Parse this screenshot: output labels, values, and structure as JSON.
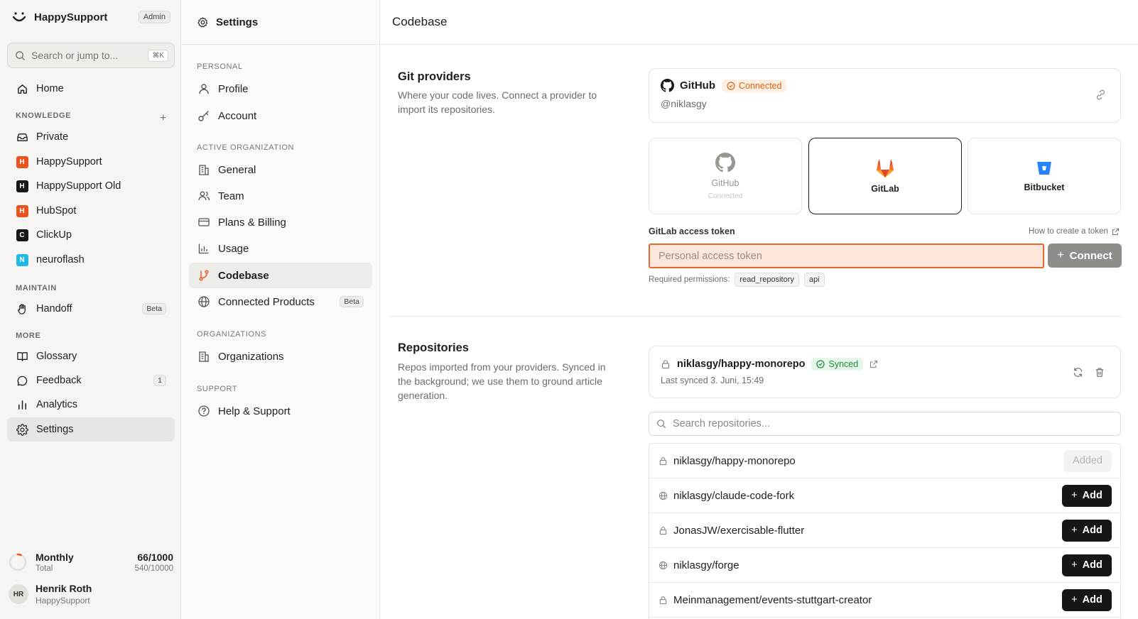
{
  "app": {
    "name": "HappySupport",
    "role_badge": "Admin",
    "search_placeholder": "Search or jump to...",
    "search_shortcut": "⌘K",
    "home": "Home",
    "sections": {
      "knowledge": "KNOWLEDGE",
      "maintain": "MAINTAIN",
      "more": "MORE"
    },
    "knowledge_bases": [
      {
        "label": "Private",
        "icon": "inbox-icon"
      },
      {
        "label": "HappySupport",
        "letter": "H",
        "color": "#e8541f"
      },
      {
        "label": "HappySupport Old",
        "letter": "H",
        "color": "#161616"
      },
      {
        "label": "HubSpot",
        "letter": "H",
        "color": "#e8541f"
      },
      {
        "label": "ClickUp",
        "letter": "C",
        "color": "#161616"
      },
      {
        "label": "neuroflash",
        "letter": "N",
        "color": "#22b8e6"
      }
    ],
    "maintain": {
      "handoff": "Handoff",
      "handoff_badge": "Beta"
    },
    "more": {
      "glossary": "Glossary",
      "feedback": "Feedback",
      "feedback_count": "1",
      "analytics": "Analytics",
      "settings": "Settings"
    },
    "usage": {
      "period": "Monthly",
      "total_label": "Total",
      "monthly_value": "66/1000",
      "total_value": "540/10000",
      "monthly_fraction": 0.066
    },
    "user": {
      "initials": "HR",
      "name": "Henrik Roth",
      "org": "HappySupport"
    }
  },
  "settings": {
    "title": "Settings",
    "groups": {
      "personal": "PERSONAL",
      "active_org": "ACTIVE ORGANIZATION",
      "organizations": "ORGANIZATIONS",
      "support": "SUPPORT"
    },
    "items": {
      "profile": "Profile",
      "account": "Account",
      "general": "General",
      "team": "Team",
      "plans": "Plans & Billing",
      "usage": "Usage",
      "codebase": "Codebase",
      "connected_products": "Connected Products",
      "connected_products_badge": "Beta",
      "organizations": "Organizations",
      "help": "Help & Support"
    }
  },
  "main": {
    "title": "Codebase",
    "git": {
      "title": "Git providers",
      "description": "Where your code lives. Connect a provider to import its repositories.",
      "connected": {
        "provider": "GitHub",
        "status": "Connected",
        "handle": "@niklasgy"
      },
      "providers": [
        {
          "name": "GitHub",
          "sub": "Connected"
        },
        {
          "name": "GitLab"
        },
        {
          "name": "Bitbucket"
        }
      ],
      "token_label": "GitLab access token",
      "howto_link": "How to create a token",
      "token_placeholder": "Personal access token",
      "connect_button": "Connect",
      "permissions_label": "Required permissions:",
      "permissions": [
        "read_repository",
        "api"
      ]
    },
    "repos": {
      "title": "Repositories",
      "description": "Repos imported from your providers. Synced in the background; we use them to ground article generation.",
      "synced": {
        "name": "niklasgy/happy-monorepo",
        "status": "Synced",
        "last_synced": "Last synced 3. Juni, 15:49"
      },
      "search_placeholder": "Search repositories...",
      "added_label": "Added",
      "add_label": "Add",
      "list": [
        {
          "name": "niklasgy/happy-monorepo",
          "visibility": "private",
          "added": true
        },
        {
          "name": "niklasgy/claude-code-fork",
          "visibility": "public",
          "added": false
        },
        {
          "name": "JonasJW/exercisable-flutter",
          "visibility": "private",
          "added": false
        },
        {
          "name": "niklasgy/forge",
          "visibility": "public",
          "added": false
        },
        {
          "name": "Meinmanagement/events-stuttgart-creator",
          "visibility": "private",
          "added": false
        }
      ]
    }
  }
}
